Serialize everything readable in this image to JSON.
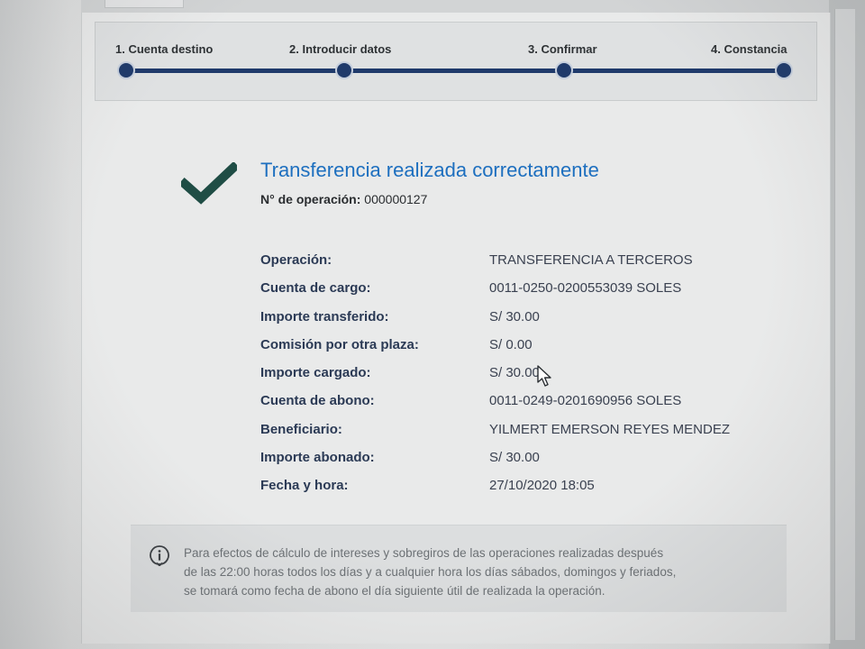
{
  "stepper": {
    "steps": [
      {
        "label": "1. Cuenta destino"
      },
      {
        "label": "2. Introducir datos"
      },
      {
        "label": "3. Confirmar"
      },
      {
        "label": "4. Constancia"
      }
    ]
  },
  "result": {
    "title": "Transferencia realizada correctamente",
    "operation_number_label": "N° de operación:",
    "operation_number_value": "000000127"
  },
  "details": [
    {
      "label": "Operación:",
      "value": "TRANSFERENCIA A TERCEROS"
    },
    {
      "label": "Cuenta de cargo:",
      "value": "0011-0250-0200553039 SOLES"
    },
    {
      "label": "Importe transferido:",
      "value": "S/ 30.00"
    },
    {
      "label": "Comisión por otra plaza:",
      "value": "S/ 0.00"
    },
    {
      "label": "Importe cargado:",
      "value": "S/ 30.00"
    },
    {
      "label": "Cuenta de abono:",
      "value": "0011-0249-0201690956 SOLES"
    },
    {
      "label": "Beneficiario:",
      "value": "YILMERT EMERSON REYES MENDEZ"
    },
    {
      "label": "Importe abonado:",
      "value": "S/ 30.00"
    },
    {
      "label": "Fecha y hora:",
      "value": "27/10/2020 18:05"
    }
  ],
  "notice": {
    "lines": [
      "Para efectos de cálculo de intereses y sobregiros de las operaciones realizadas después",
      "de las 22:00 horas todos los días y a cualquier hora los días sábados, domingos y feriados,",
      "se tomará como fecha de abono el día siguiente útil de realizada la operación."
    ]
  },
  "icons": {
    "success": "checkmark-icon",
    "notice": "info-icon",
    "pointer": "mouse-cursor-icon"
  },
  "colors": {
    "accent": "#1d6fbf",
    "check": "#1f4d45",
    "stepper": "#1f3a6b"
  }
}
